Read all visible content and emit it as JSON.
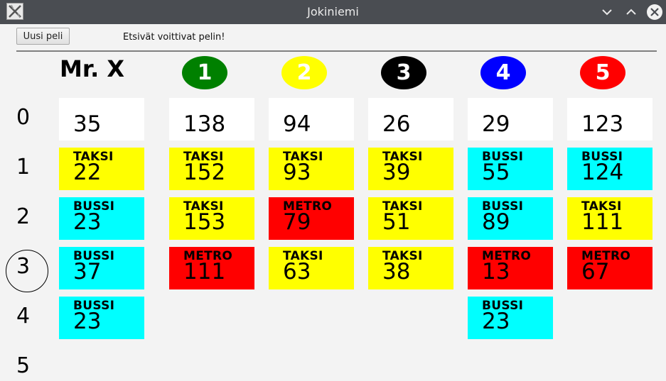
{
  "window": {
    "title": "Jokiniemi"
  },
  "toolbar": {
    "new_game_label": "Uusi peli",
    "status_text": "Etsivät voittivat pelin!"
  },
  "columns": [
    {
      "header": "Mr. X",
      "badge_color": null,
      "text_color": "#000000"
    },
    {
      "header": "1",
      "badge_color": "#008000",
      "text_color": "#ffffff"
    },
    {
      "header": "2",
      "badge_color": "#ffff00",
      "text_color": "#ffffff"
    },
    {
      "header": "3",
      "badge_color": "#000000",
      "text_color": "#ffffff"
    },
    {
      "header": "4",
      "badge_color": "#0000ff",
      "text_color": "#ffffff"
    },
    {
      "header": "5",
      "badge_color": "#ff0000",
      "text_color": "#ffffff"
    }
  ],
  "rounds": [
    "0",
    "1",
    "2",
    "3",
    "4",
    "5"
  ],
  "current_round": "3",
  "transport_colors": {
    "TAKSI": "#ffff00",
    "BUSSI": "#00ffff",
    "METRO": "#ff0000",
    "START": "#ffffff"
  },
  "moves": [
    [
      {
        "kind": "",
        "pos": "35"
      },
      {
        "kind": "TAKSI",
        "pos": "22"
      },
      {
        "kind": "BUSSI",
        "pos": "23"
      },
      {
        "kind": "BUSSI",
        "pos": "37"
      },
      {
        "kind": "BUSSI",
        "pos": "23"
      }
    ],
    [
      {
        "kind": "",
        "pos": "138"
      },
      {
        "kind": "TAKSI",
        "pos": "152"
      },
      {
        "kind": "TAKSI",
        "pos": "153"
      },
      {
        "kind": "METRO",
        "pos": "111"
      }
    ],
    [
      {
        "kind": "",
        "pos": "94"
      },
      {
        "kind": "TAKSI",
        "pos": "93"
      },
      {
        "kind": "METRO",
        "pos": "79"
      },
      {
        "kind": "TAKSI",
        "pos": "63"
      }
    ],
    [
      {
        "kind": "",
        "pos": "26"
      },
      {
        "kind": "TAKSI",
        "pos": "39"
      },
      {
        "kind": "TAKSI",
        "pos": "51"
      },
      {
        "kind": "TAKSI",
        "pos": "38"
      }
    ],
    [
      {
        "kind": "",
        "pos": "29"
      },
      {
        "kind": "BUSSI",
        "pos": "55"
      },
      {
        "kind": "BUSSI",
        "pos": "89"
      },
      {
        "kind": "METRO",
        "pos": "13"
      },
      {
        "kind": "BUSSI",
        "pos": "23"
      }
    ],
    [
      {
        "kind": "",
        "pos": "123"
      },
      {
        "kind": "BUSSI",
        "pos": "124"
      },
      {
        "kind": "TAKSI",
        "pos": "111"
      },
      {
        "kind": "METRO",
        "pos": "67"
      }
    ]
  ]
}
